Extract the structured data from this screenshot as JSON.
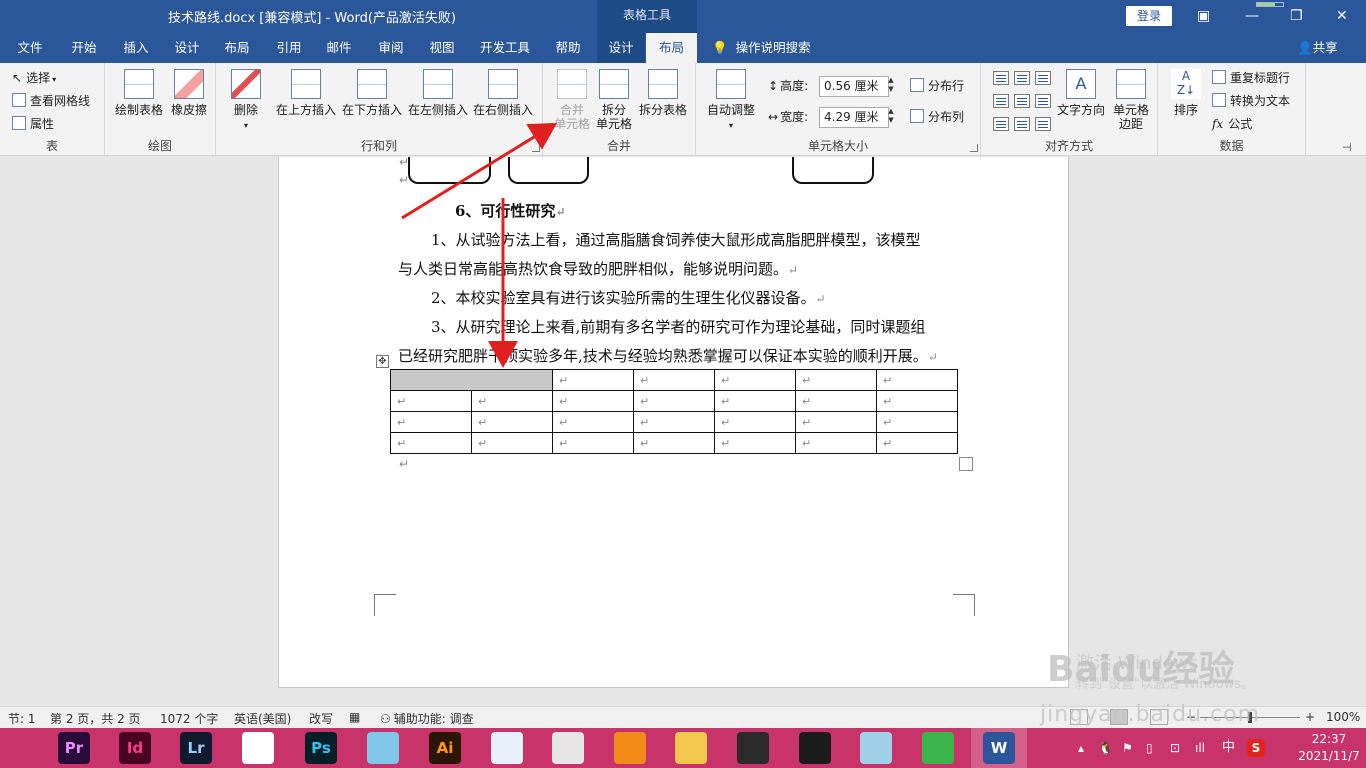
{
  "titlebar": {
    "doc_title": "技术路线.docx [兼容模式]  -  Word(产品激活失败)",
    "context_tools": "表格工具",
    "login": "登录"
  },
  "tabs": [
    {
      "label": "文件",
      "name": "tab-file"
    },
    {
      "label": "开始",
      "name": "tab-home"
    },
    {
      "label": "插入",
      "name": "tab-insert"
    },
    {
      "label": "设计",
      "name": "tab-design"
    },
    {
      "label": "布局",
      "name": "tab-page-layout"
    },
    {
      "label": "引用",
      "name": "tab-references"
    },
    {
      "label": "邮件",
      "name": "tab-mailings"
    },
    {
      "label": "审阅",
      "name": "tab-review"
    },
    {
      "label": "视图",
      "name": "tab-view"
    },
    {
      "label": "开发工具",
      "name": "tab-developer"
    },
    {
      "label": "帮助",
      "name": "tab-help"
    },
    {
      "label": "设计",
      "name": "tab-table-design"
    },
    {
      "label": "布局",
      "name": "tab-table-layout"
    }
  ],
  "tell_me": "操作说明搜索",
  "share": "共享",
  "ribbon": {
    "table": {
      "select": "选择",
      "gridlines": "查看网格线",
      "properties": "属性",
      "label": "表"
    },
    "draw": {
      "draw_table": "绘制表格",
      "eraser": "橡皮擦",
      "label": "绘图"
    },
    "rows_cols": {
      "delete": "删除",
      "insert_above": "在上方插入",
      "insert_below": "在下方插入",
      "insert_left": "在左侧插入",
      "insert_right": "在右侧插入",
      "label": "行和列"
    },
    "merge": {
      "merge_cells_1": "合并",
      "merge_cells_2": "单元格",
      "split_cells_1": "拆分",
      "split_cells_2": "单元格",
      "split_table": "拆分表格",
      "label": "合并"
    },
    "cell_size": {
      "autofit": "自动调整",
      "height_label": "高度:",
      "height_value": "0.56 厘米",
      "width_label": "宽度:",
      "width_value": "4.29 厘米",
      "distribute_rows": "分布行",
      "distribute_cols": "分布列",
      "label": "单元格大小"
    },
    "alignment": {
      "text_direction": "文字方向",
      "cell_margins_1": "单元格",
      "cell_margins_2": "边距",
      "label": "对齐方式"
    },
    "data": {
      "sort": "排序",
      "repeat_header": "重复标题行",
      "convert_text": "转换为文本",
      "formula": "公式",
      "label": "数据"
    }
  },
  "document": {
    "heading": "6、可行性研究",
    "lines": [
      "1、从试验方法上看，通过高脂膳食饲养使大鼠形成高脂肥胖模型，该模型",
      "与人类日常高能高热饮食导致的肥胖相似，能够说明问题。",
      "2、本校实验室具有进行该实验所需的生理生化仪器设备。",
      "3、从研究理论上来看,前期有多名学者的研究可作为理论基础，同时课题组",
      "已经研究肥胖干预实验多年,技术与经验均熟悉掌握可以保证本实验的顺利开展。"
    ],
    "para_mark": "↵",
    "table_rows": 4,
    "table_cols": 7,
    "watermark_line1": "激活 Windows",
    "watermark_line2": "转到\"设置\"以激活 Windows。"
  },
  "baidu": {
    "logo": "Baidu经验",
    "url": "jingyan.baidu.com"
  },
  "statusbar": {
    "section": "节: 1",
    "page": "第 2 页，共 2 页",
    "words": "1072 个字",
    "language": "英语(美国)",
    "mode": "改写",
    "accessibility": "辅助功能: 调查",
    "zoom": "100%"
  },
  "taskbar": {
    "apps": [
      {
        "label": "Pr",
        "name": "premiere-icon",
        "color": "#2a0a3a",
        "fg": "#e88cff"
      },
      {
        "label": "Id",
        "name": "indesign-icon",
        "color": "#49021f",
        "fg": "#ff3b8a"
      },
      {
        "label": "Lr",
        "name": "lightroom-icon",
        "color": "#0f1b2c",
        "fg": "#9ecbff"
      },
      {
        "label": "",
        "name": "pinwheel-app-icon",
        "color": "#ffffff",
        "fg": "#d22"
      },
      {
        "label": "Ps",
        "name": "photoshop-icon",
        "color": "#061e26",
        "fg": "#31c5f4"
      },
      {
        "label": "",
        "name": "cat-app-icon",
        "color": "#7fc6e8",
        "fg": "#fff"
      },
      {
        "label": "Ai",
        "name": "illustrator-icon",
        "color": "#2b1500",
        "fg": "#ff9a00"
      },
      {
        "label": "",
        "name": "browser-blue-icon",
        "color": "#e8f1fb",
        "fg": "#2a6fd6"
      },
      {
        "label": "",
        "name": "chrome-icon",
        "color": "#e6e6e6",
        "fg": "#db4437"
      },
      {
        "label": "",
        "name": "orange-app-icon",
        "color": "#f28a1a",
        "fg": "#fff"
      },
      {
        "label": "",
        "name": "file-explorer-icon",
        "color": "#f2c94c",
        "fg": "#7a5a00"
      },
      {
        "label": "",
        "name": "video-editor-icon",
        "color": "#2a2a2a",
        "fg": "#fff"
      },
      {
        "label": "",
        "name": "qq-icon",
        "color": "#1b1b1b",
        "fg": "#fff"
      },
      {
        "label": "",
        "name": "notepad-icon",
        "color": "#9fd0e8",
        "fg": "#333"
      },
      {
        "label": "",
        "name": "feishu-icon",
        "color": "#3bb54a",
        "fg": "#fff"
      },
      {
        "label": "W",
        "name": "word-icon",
        "color": "#2b579a",
        "fg": "#fff"
      }
    ],
    "ime": "中",
    "time": "22:37",
    "date": "2021/11/7"
  },
  "colors": {
    "word_blue": "#2b579a",
    "taskbar": "#c8336a",
    "arrow_red": "#e02020"
  }
}
